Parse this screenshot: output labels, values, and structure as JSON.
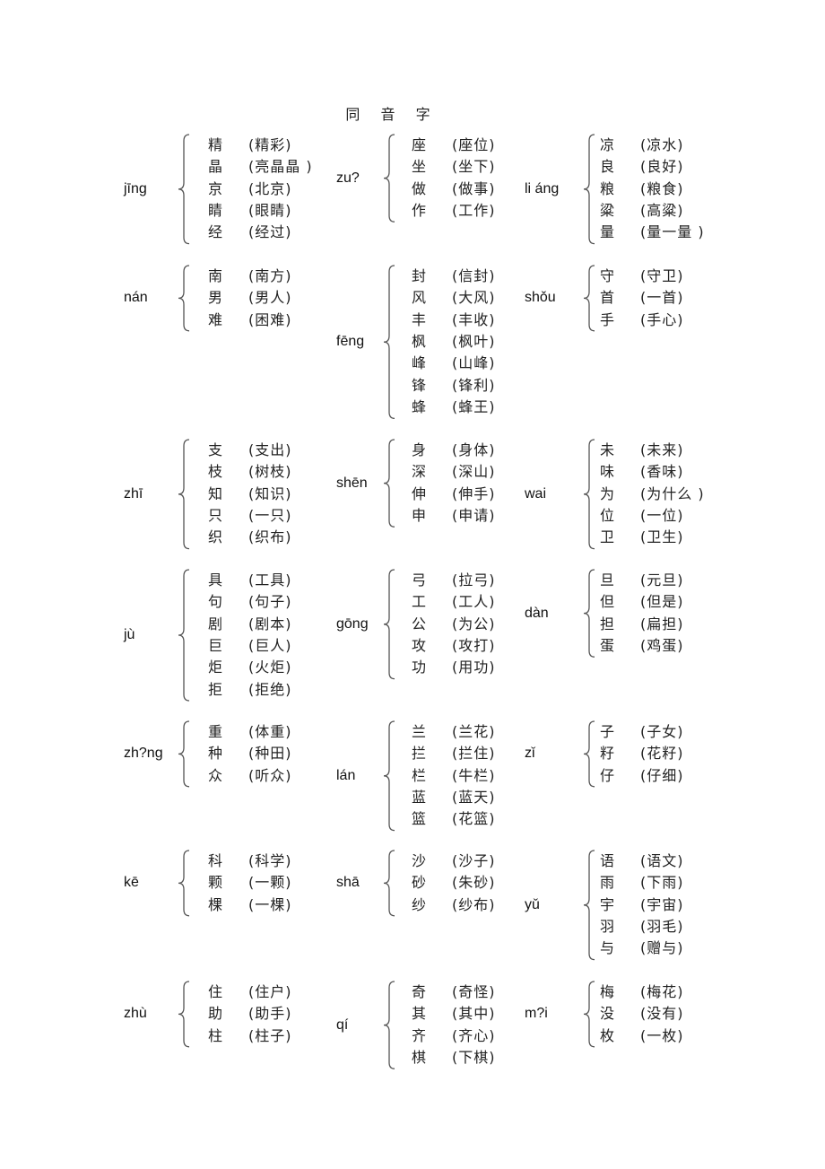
{
  "title": "同 音 字",
  "groups": [
    {
      "pinyin": "jīng",
      "entries": [
        {
          "char": "精",
          "word": "(精彩)"
        },
        {
          "char": "晶",
          "word": "(亮晶晶 )"
        },
        {
          "char": "京",
          "word": "(北京)"
        },
        {
          "char": "睛",
          "word": "(眼睛)"
        },
        {
          "char": "经",
          "word": "(经过)"
        }
      ]
    },
    {
      "pinyin": "zu?",
      "entries": [
        {
          "char": "座",
          "word": "(座位)"
        },
        {
          "char": "坐",
          "word": "(坐下)"
        },
        {
          "char": "做",
          "word": "(做事)"
        },
        {
          "char": "作",
          "word": "(工作)"
        }
      ]
    },
    {
      "pinyin": "li áng",
      "entries": [
        {
          "char": "凉",
          "word": "(凉水)"
        },
        {
          "char": "良",
          "word": "(良好)"
        },
        {
          "char": "粮",
          "word": "(粮食)"
        },
        {
          "char": "粱",
          "word": "(高粱)"
        },
        {
          "char": "量",
          "word": "(量一量 )"
        }
      ]
    },
    {
      "pinyin": "nán",
      "entries": [
        {
          "char": "南",
          "word": "(南方)"
        },
        {
          "char": "男",
          "word": "(男人)"
        },
        {
          "char": "难",
          "word": "(困难)"
        }
      ]
    },
    {
      "pinyin": "fēng",
      "entries": [
        {
          "char": "封",
          "word": "(信封)"
        },
        {
          "char": "风",
          "word": "(大风)"
        },
        {
          "char": "丰",
          "word": "(丰收)"
        },
        {
          "char": "枫",
          "word": "(枫叶)"
        },
        {
          "char": "峰",
          "word": "(山峰)"
        },
        {
          "char": "锋",
          "word": "(锋利)"
        },
        {
          "char": "蜂",
          "word": "(蜂王)"
        }
      ]
    },
    {
      "pinyin": "shǒu",
      "entries": [
        {
          "char": "守",
          "word": "(守卫)"
        },
        {
          "char": "首",
          "word": "(一首)"
        },
        {
          "char": "手",
          "word": "(手心)"
        }
      ]
    },
    {
      "pinyin": "zhī",
      "entries": [
        {
          "char": "支",
          "word": "(支出)"
        },
        {
          "char": "枝",
          "word": "(树枝)"
        },
        {
          "char": "知",
          "word": "(知识)"
        },
        {
          "char": "只",
          "word": "(一只)"
        },
        {
          "char": "织",
          "word": "(织布)"
        }
      ]
    },
    {
      "pinyin": "shēn",
      "entries": [
        {
          "char": "身",
          "word": "(身体)"
        },
        {
          "char": "深",
          "word": "(深山)"
        },
        {
          "char": "伸",
          "word": "(伸手)"
        },
        {
          "char": "申",
          "word": "(申请)"
        }
      ]
    },
    {
      "pinyin": "wai",
      "entries": [
        {
          "char": "未",
          "word": "(未来)"
        },
        {
          "char": "味",
          "word": "(香味)"
        },
        {
          "char": "为",
          "word": "(为什么 )"
        },
        {
          "char": "位",
          "word": "(一位)"
        },
        {
          "char": "卫",
          "word": "(卫生)"
        }
      ]
    },
    {
      "pinyin": "jù",
      "entries": [
        {
          "char": "具",
          "word": "(工具)"
        },
        {
          "char": "句",
          "word": "(句子)"
        },
        {
          "char": "剧",
          "word": "(剧本)"
        },
        {
          "char": "巨",
          "word": "(巨人)"
        },
        {
          "char": "炬",
          "word": "(火炬)"
        },
        {
          "char": "拒",
          "word": "(拒绝)"
        }
      ]
    },
    {
      "pinyin": "gōng",
      "entries": [
        {
          "char": "弓",
          "word": "(拉弓)"
        },
        {
          "char": "工",
          "word": "(工人)"
        },
        {
          "char": "公",
          "word": "(为公)"
        },
        {
          "char": "攻",
          "word": "(攻打)"
        },
        {
          "char": "功",
          "word": "(用功)"
        }
      ]
    },
    {
      "pinyin": "dàn",
      "entries": [
        {
          "char": "旦",
          "word": "(元旦)"
        },
        {
          "char": "但",
          "word": "(但是)"
        },
        {
          "char": "担",
          "word": "(扁担)"
        },
        {
          "char": "蛋",
          "word": "(鸡蛋)"
        }
      ]
    },
    {
      "pinyin": "zh?ng",
      "entries": [
        {
          "char": "重",
          "word": "(体重)"
        },
        {
          "char": "种",
          "word": "(种田)"
        },
        {
          "char": "众",
          "word": "(听众)"
        }
      ]
    },
    {
      "pinyin": "lán",
      "entries": [
        {
          "char": "兰",
          "word": "(兰花)"
        },
        {
          "char": "拦",
          "word": "(拦住)"
        },
        {
          "char": "栏",
          "word": "(牛栏)"
        },
        {
          "char": "蓝",
          "word": "(蓝天)"
        },
        {
          "char": "篮",
          "word": "(花篮)"
        }
      ]
    },
    {
      "pinyin": "zǐ",
      "entries": [
        {
          "char": "子",
          "word": "(子女)"
        },
        {
          "char": "籽",
          "word": "(花籽)"
        },
        {
          "char": "仔",
          "word": "(仔细)"
        }
      ]
    },
    {
      "pinyin": "kē",
      "entries": [
        {
          "char": "科",
          "word": "(科学)"
        },
        {
          "char": "颗",
          "word": "(一颗)"
        },
        {
          "char": "棵",
          "word": "(一棵)"
        }
      ]
    },
    {
      "pinyin": "shā",
      "entries": [
        {
          "char": "沙",
          "word": "(沙子)"
        },
        {
          "char": "砂",
          "word": "(朱砂)"
        },
        {
          "char": "纱",
          "word": "(纱布)"
        }
      ]
    },
    {
      "pinyin": "yǔ",
      "entries": [
        {
          "char": "语",
          "word": "(语文)"
        },
        {
          "char": "雨",
          "word": "(下雨)"
        },
        {
          "char": "宇",
          "word": "(宇宙)"
        },
        {
          "char": "羽",
          "word": "(羽毛)"
        },
        {
          "char": "与",
          "word": "(赠与)"
        }
      ]
    },
    {
      "pinyin": "zhù",
      "entries": [
        {
          "char": "住",
          "word": "(住户)"
        },
        {
          "char": "助",
          "word": "(助手)"
        },
        {
          "char": "柱",
          "word": "(柱子)"
        }
      ]
    },
    {
      "pinyin": "qí",
      "entries": [
        {
          "char": "奇",
          "word": "(奇怪)"
        },
        {
          "char": "其",
          "word": "(其中)"
        },
        {
          "char": "齐",
          "word": "(齐心)"
        },
        {
          "char": "棋",
          "word": "(下棋)"
        }
      ]
    },
    {
      "pinyin": "m?i",
      "entries": [
        {
          "char": "梅",
          "word": "(梅花)"
        },
        {
          "char": "没",
          "word": "(没有)"
        },
        {
          "char": "枚",
          "word": "(一枚)"
        }
      ]
    }
  ]
}
